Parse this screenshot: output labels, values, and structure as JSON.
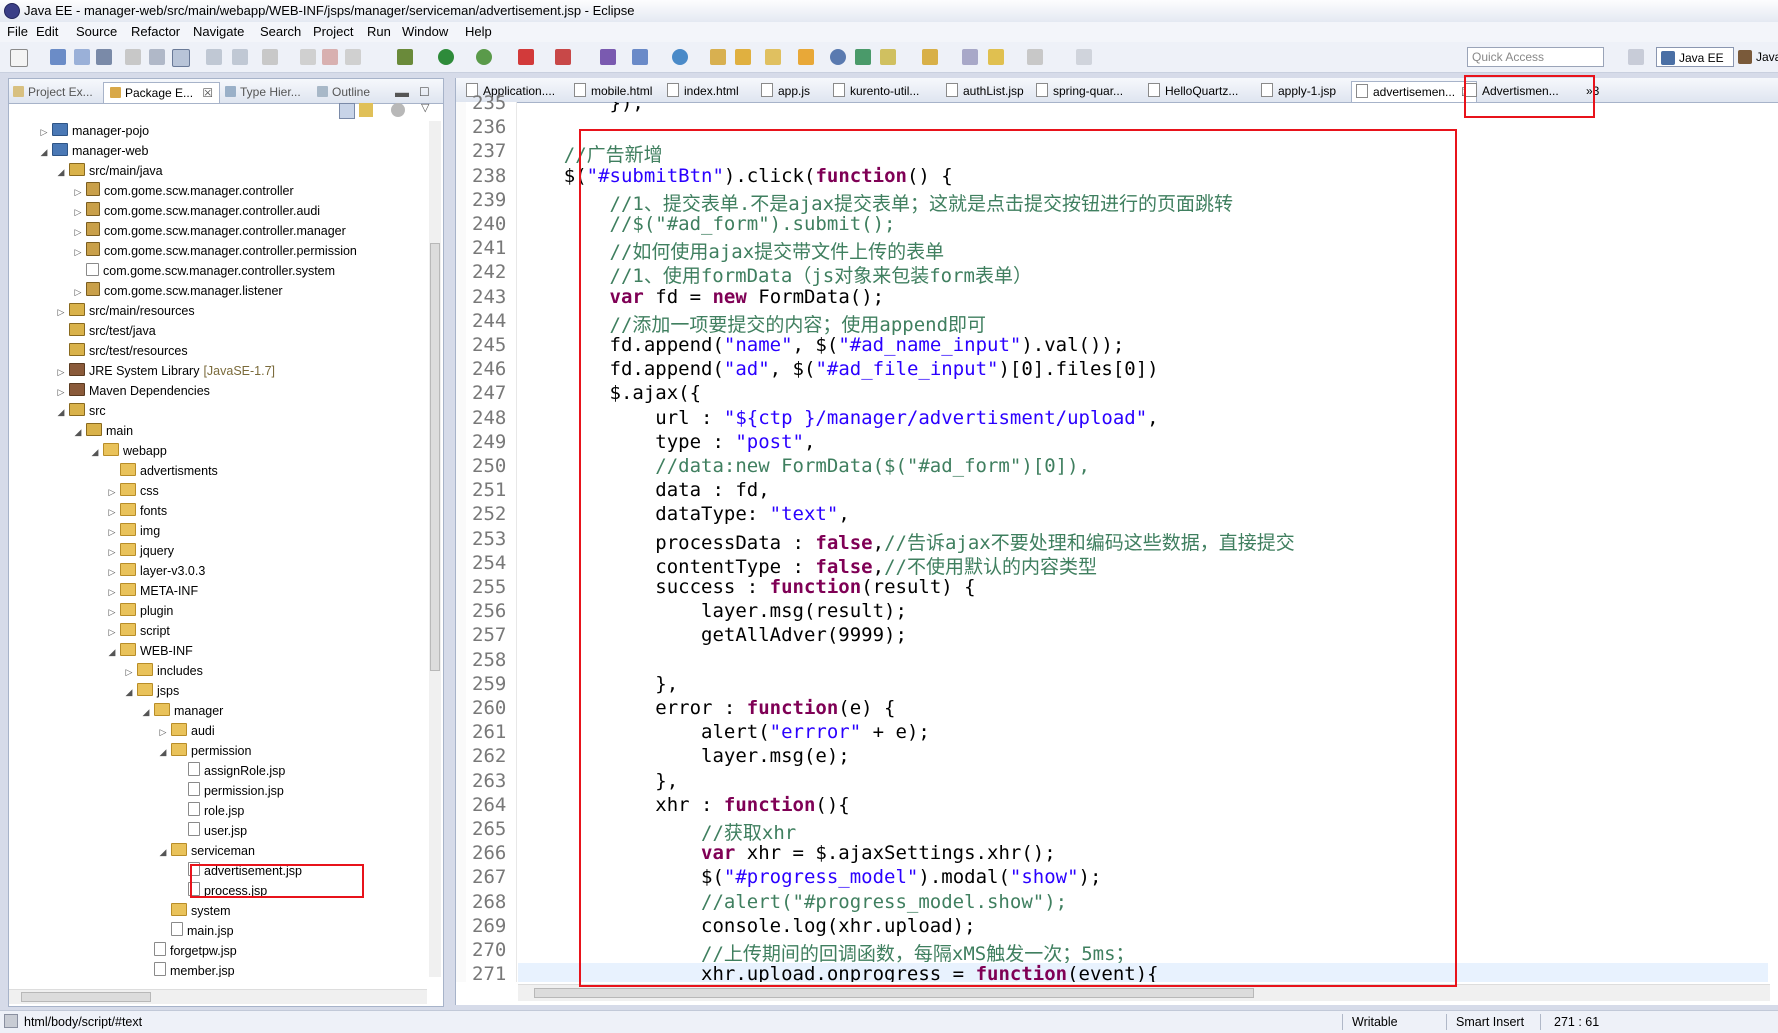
{
  "window": {
    "title": "Java EE - manager-web/src/main/webapp/WEB-INF/jsps/manager/serviceman/advertisement.jsp - Eclipse"
  },
  "menu": [
    "File",
    "Edit",
    "Source",
    "Refactor",
    "Navigate",
    "Search",
    "Project",
    "Run",
    "Window",
    "Help"
  ],
  "toolbar": {
    "quick_access_placeholder": "Quick Access",
    "perspective_javaee": "Java EE",
    "perspective_java": "Java"
  },
  "left_tabs": [
    {
      "label": "Project Ex...",
      "icon": "project-explorer-icon"
    },
    {
      "label": "Package E...",
      "icon": "package-explorer-icon",
      "active": true
    },
    {
      "label": "Type Hier...",
      "icon": "type-hierarchy-icon"
    },
    {
      "label": "Outline",
      "icon": "outline-icon"
    }
  ],
  "tree": [
    {
      "depth": 0,
      "twisty": "▷",
      "icon": "proj",
      "label": "manager-pojo"
    },
    {
      "depth": 0,
      "twisty": "◢",
      "icon": "proj",
      "label": "manager-web"
    },
    {
      "depth": 1,
      "twisty": "◢",
      "icon": "srcf",
      "label": "src/main/java"
    },
    {
      "depth": 2,
      "twisty": "▷",
      "icon": "pkg",
      "label": "com.gome.scw.manager.controller"
    },
    {
      "depth": 2,
      "twisty": "▷",
      "icon": "pkg",
      "label": "com.gome.scw.manager.controller.audi"
    },
    {
      "depth": 2,
      "twisty": "▷",
      "icon": "pkg",
      "label": "com.gome.scw.manager.controller.manager"
    },
    {
      "depth": 2,
      "twisty": "▷",
      "icon": "pkg",
      "label": "com.gome.scw.manager.controller.permission"
    },
    {
      "depth": 2,
      "twisty": "",
      "icon": "pkge",
      "label": "com.gome.scw.manager.controller.system"
    },
    {
      "depth": 2,
      "twisty": "▷",
      "icon": "pkg",
      "label": "com.gome.scw.manager.listener"
    },
    {
      "depth": 1,
      "twisty": "▷",
      "icon": "srcf",
      "label": "src/main/resources"
    },
    {
      "depth": 1,
      "twisty": "",
      "icon": "srcf",
      "label": "src/test/java"
    },
    {
      "depth": 1,
      "twisty": "",
      "icon": "srcf",
      "label": "src/test/resources"
    },
    {
      "depth": 1,
      "twisty": "▷",
      "icon": "lib",
      "label": "JRE System Library",
      "extra": "[JavaSE-1.7]"
    },
    {
      "depth": 1,
      "twisty": "▷",
      "icon": "lib",
      "label": "Maven Dependencies"
    },
    {
      "depth": 1,
      "twisty": "◢",
      "icon": "srcf",
      "label": "src"
    },
    {
      "depth": 2,
      "twisty": "◢",
      "icon": "srcf",
      "label": "main"
    },
    {
      "depth": 3,
      "twisty": "◢",
      "icon": "folder",
      "label": "webapp"
    },
    {
      "depth": 4,
      "twisty": "",
      "icon": "folder",
      "label": "advertisments"
    },
    {
      "depth": 4,
      "twisty": "▷",
      "icon": "folder",
      "label": "css"
    },
    {
      "depth": 4,
      "twisty": "▷",
      "icon": "folder",
      "label": "fonts"
    },
    {
      "depth": 4,
      "twisty": "▷",
      "icon": "folder",
      "label": "img"
    },
    {
      "depth": 4,
      "twisty": "▷",
      "icon": "folder",
      "label": "jquery"
    },
    {
      "depth": 4,
      "twisty": "▷",
      "icon": "folder",
      "label": "layer-v3.0.3"
    },
    {
      "depth": 4,
      "twisty": "▷",
      "icon": "folder",
      "label": "META-INF"
    },
    {
      "depth": 4,
      "twisty": "▷",
      "icon": "folder",
      "label": "plugin"
    },
    {
      "depth": 4,
      "twisty": "▷",
      "icon": "folder",
      "label": "script"
    },
    {
      "depth": 4,
      "twisty": "◢",
      "icon": "folder",
      "label": "WEB-INF"
    },
    {
      "depth": 5,
      "twisty": "▷",
      "icon": "folder",
      "label": "includes"
    },
    {
      "depth": 5,
      "twisty": "◢",
      "icon": "folder",
      "label": "jsps"
    },
    {
      "depth": 6,
      "twisty": "◢",
      "icon": "folder",
      "label": "manager"
    },
    {
      "depth": 7,
      "twisty": "▷",
      "icon": "folder",
      "label": "audi"
    },
    {
      "depth": 7,
      "twisty": "◢",
      "icon": "folder",
      "label": "permission"
    },
    {
      "depth": 8,
      "twisty": "",
      "icon": "file",
      "label": "assignRole.jsp"
    },
    {
      "depth": 8,
      "twisty": "",
      "icon": "file",
      "label": "permission.jsp"
    },
    {
      "depth": 8,
      "twisty": "",
      "icon": "file",
      "label": "role.jsp"
    },
    {
      "depth": 8,
      "twisty": "",
      "icon": "file",
      "label": "user.jsp"
    },
    {
      "depth": 7,
      "twisty": "◢",
      "icon": "folder",
      "label": "serviceman"
    },
    {
      "depth": 8,
      "twisty": "",
      "icon": "file",
      "label": "advertisement.jsp",
      "highlight": true
    },
    {
      "depth": 8,
      "twisty": "",
      "icon": "file",
      "label": "process.jsp"
    },
    {
      "depth": 7,
      "twisty": "",
      "icon": "folder",
      "label": "system"
    },
    {
      "depth": 7,
      "twisty": "",
      "icon": "file",
      "label": "main.jsp"
    },
    {
      "depth": 6,
      "twisty": "",
      "icon": "file",
      "label": "forgetpw.jsp"
    },
    {
      "depth": 6,
      "twisty": "",
      "icon": "file",
      "label": "member.jsp"
    }
  ],
  "editor_tabs": [
    {
      "label": "Application...."
    },
    {
      "label": "mobile.html"
    },
    {
      "label": "index.html"
    },
    {
      "label": "app.js"
    },
    {
      "label": "kurento-util..."
    },
    {
      "label": "authList.jsp"
    },
    {
      "label": "spring-quar..."
    },
    {
      "label": "HelloQuartz..."
    },
    {
      "label": "apply-1.jsp"
    },
    {
      "label": "advertisemen...",
      "active": true
    },
    {
      "label": "Advertismen..."
    }
  ],
  "editor_tabs_overflow": "»3",
  "code": [
    {
      "n": "235",
      "t": [
        {
          "c": "",
          "s": "        });"
        }
      ]
    },
    {
      "n": "236",
      "t": []
    },
    {
      "n": "237",
      "t": [
        {
          "c": "cm",
          "s": "    //广告新增"
        }
      ]
    },
    {
      "n": "238",
      "t": [
        {
          "c": "",
          "s": "    $("
        },
        {
          "c": "str",
          "s": "\"#submitBtn\""
        },
        {
          "c": "",
          "s": ").click("
        },
        {
          "c": "kw",
          "s": "function"
        },
        {
          "c": "",
          "s": "() {"
        }
      ]
    },
    {
      "n": "239",
      "t": [
        {
          "c": "cm",
          "s": "        //1、提交表单.不是ajax提交表单；这就是点击提交按钮进行的页面跳转"
        }
      ]
    },
    {
      "n": "240",
      "t": [
        {
          "c": "cm",
          "s": "        //$(\"#ad_form\").submit();"
        }
      ]
    },
    {
      "n": "241",
      "t": [
        {
          "c": "cm",
          "s": "        //如何使用ajax提交带文件上传的表单"
        }
      ]
    },
    {
      "n": "242",
      "t": [
        {
          "c": "cm",
          "s": "        //1、使用formData（js对象来包装form表单）"
        }
      ]
    },
    {
      "n": "243",
      "t": [
        {
          "c": "kw",
          "s": "        var"
        },
        {
          "c": "",
          "s": " fd = "
        },
        {
          "c": "kw",
          "s": "new"
        },
        {
          "c": "",
          "s": " FormData();"
        }
      ]
    },
    {
      "n": "244",
      "t": [
        {
          "c": "cm",
          "s": "        //添加一项要提交的内容；使用append即可"
        }
      ]
    },
    {
      "n": "245",
      "t": [
        {
          "c": "",
          "s": "        fd.append("
        },
        {
          "c": "str",
          "s": "\"name\""
        },
        {
          "c": "",
          "s": ", $("
        },
        {
          "c": "str",
          "s": "\"#ad_name_input\""
        },
        {
          "c": "",
          "s": ").val());"
        }
      ]
    },
    {
      "n": "246",
      "t": [
        {
          "c": "",
          "s": "        fd.append("
        },
        {
          "c": "str",
          "s": "\"ad\""
        },
        {
          "c": "",
          "s": ", $("
        },
        {
          "c": "str",
          "s": "\"#ad_file_input\""
        },
        {
          "c": "",
          "s": ")[0].files[0])"
        }
      ]
    },
    {
      "n": "247",
      "t": [
        {
          "c": "",
          "s": "        $.ajax({"
        }
      ]
    },
    {
      "n": "248",
      "t": [
        {
          "c": "",
          "s": "            url : "
        },
        {
          "c": "str",
          "s": "\"${ctp }/manager/advertisment/upload\""
        },
        {
          "c": "",
          "s": ","
        }
      ]
    },
    {
      "n": "249",
      "t": [
        {
          "c": "",
          "s": "            type : "
        },
        {
          "c": "str",
          "s": "\"post\""
        },
        {
          "c": "",
          "s": ","
        }
      ]
    },
    {
      "n": "250",
      "t": [
        {
          "c": "cm",
          "s": "            //data:new FormData($(\"#ad_form\")[0]),"
        }
      ]
    },
    {
      "n": "251",
      "t": [
        {
          "c": "",
          "s": "            data : fd,"
        }
      ]
    },
    {
      "n": "252",
      "t": [
        {
          "c": "",
          "s": "            dataType: "
        },
        {
          "c": "str",
          "s": "\"text\""
        },
        {
          "c": "",
          "s": ","
        }
      ]
    },
    {
      "n": "253",
      "t": [
        {
          "c": "",
          "s": "            processData : "
        },
        {
          "c": "kw",
          "s": "false"
        },
        {
          "c": "",
          "s": ","
        },
        {
          "c": "cm",
          "s": "//告诉ajax不要处理和编码这些数据，直接提交"
        }
      ]
    },
    {
      "n": "254",
      "t": [
        {
          "c": "",
          "s": "            contentType : "
        },
        {
          "c": "kw",
          "s": "false"
        },
        {
          "c": "",
          "s": ","
        },
        {
          "c": "cm",
          "s": "//不使用默认的内容类型"
        }
      ]
    },
    {
      "n": "255",
      "t": [
        {
          "c": "",
          "s": "            success : "
        },
        {
          "c": "kw",
          "s": "function"
        },
        {
          "c": "",
          "s": "(result) {"
        }
      ]
    },
    {
      "n": "256",
      "t": [
        {
          "c": "",
          "s": "                layer.msg(result);"
        }
      ]
    },
    {
      "n": "257",
      "t": [
        {
          "c": "",
          "s": "                getAllAdver(9999);"
        }
      ]
    },
    {
      "n": "258",
      "t": []
    },
    {
      "n": "259",
      "t": [
        {
          "c": "",
          "s": "            },"
        }
      ]
    },
    {
      "n": "260",
      "t": [
        {
          "c": "",
          "s": "            error : "
        },
        {
          "c": "kw",
          "s": "function"
        },
        {
          "c": "",
          "s": "(e) {"
        }
      ]
    },
    {
      "n": "261",
      "t": [
        {
          "c": "",
          "s": "                alert("
        },
        {
          "c": "str",
          "s": "\"errror\""
        },
        {
          "c": "",
          "s": " + e);"
        }
      ]
    },
    {
      "n": "262",
      "t": [
        {
          "c": "",
          "s": "                layer.msg(e);"
        }
      ]
    },
    {
      "n": "263",
      "t": [
        {
          "c": "",
          "s": "            },"
        }
      ]
    },
    {
      "n": "264",
      "t": [
        {
          "c": "",
          "s": "            xhr : "
        },
        {
          "c": "kw",
          "s": "function"
        },
        {
          "c": "",
          "s": "(){"
        }
      ]
    },
    {
      "n": "265",
      "t": [
        {
          "c": "cm",
          "s": "                //获取xhr"
        }
      ]
    },
    {
      "n": "266",
      "t": [
        {
          "c": "kw",
          "s": "                var"
        },
        {
          "c": "",
          "s": " xhr = $.ajaxSettings.xhr();"
        }
      ]
    },
    {
      "n": "267",
      "t": [
        {
          "c": "",
          "s": "                $("
        },
        {
          "c": "str",
          "s": "\"#progress_model\""
        },
        {
          "c": "",
          "s": ").modal("
        },
        {
          "c": "str",
          "s": "\"show\""
        },
        {
          "c": "",
          "s": ");"
        }
      ]
    },
    {
      "n": "268",
      "t": [
        {
          "c": "cm",
          "s": "                //alert(\"#progress_model.show\");"
        }
      ]
    },
    {
      "n": "269",
      "t": [
        {
          "c": "",
          "s": "                console.log(xhr.upload);"
        }
      ]
    },
    {
      "n": "270",
      "t": [
        {
          "c": "cm",
          "s": "                //上传期间的回调函数，每隔xMS触发一次；5ms；"
        }
      ]
    },
    {
      "n": "271",
      "t": [
        {
          "c": "",
          "s": "                xhr.upload.onprogress = "
        },
        {
          "c": "kw",
          "s": "function"
        },
        {
          "c": "",
          "s": "(event){"
        }
      ]
    }
  ],
  "status": {
    "path": "html/body/script/#text",
    "writable": "Writable",
    "insert_mode": "Smart Insert",
    "position": "271 : 61"
  },
  "colors": {
    "keyword": "#7f0055",
    "string": "#2a00ff",
    "comment": "#3f7f5f",
    "annotation_red": "#e8131b"
  }
}
